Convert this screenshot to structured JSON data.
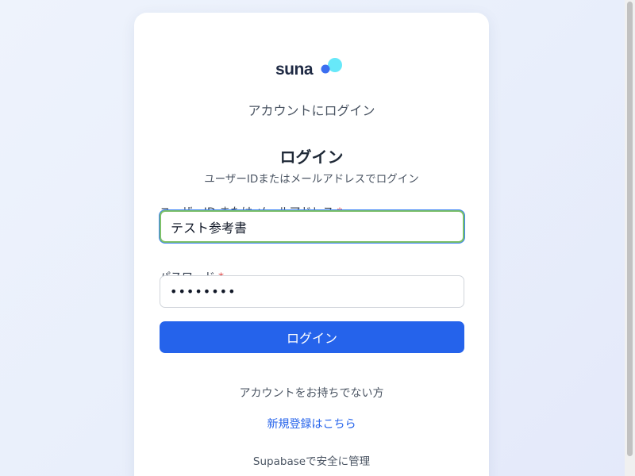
{
  "brand": {
    "name": "suna",
    "logo_icon": "bubbles-logo-icon",
    "logo_colors": [
      "#3b82f6",
      "#67e8f9"
    ]
  },
  "page": {
    "subtitle": "アカウントにログイン",
    "title": "ログイン",
    "description": "ユーザーIDまたはメールアドレスでログイン"
  },
  "form": {
    "user_label": "ユーザーID または メールアドレス",
    "user_value": "テスト参考書",
    "password_label": "パスワード",
    "password_value": "••••••••",
    "required_mark": "*",
    "submit_label": "ログイン"
  },
  "signup": {
    "prompt": "アカウントをお持ちでない方",
    "link_label": "新規登録はこちら"
  },
  "footer": {
    "note": "Supabaseで安全に管理"
  },
  "colors": {
    "accent": "#2563eb",
    "focus_border": "#7cc068",
    "required": "#dc2626"
  }
}
